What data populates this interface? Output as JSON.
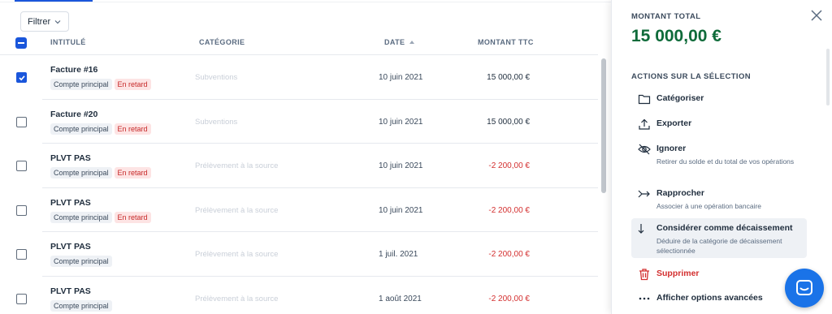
{
  "toolbar": {
    "filter_label": "Filtrer"
  },
  "table": {
    "headers": {
      "title": "INTITULÉ",
      "category": "CATÉGORIE",
      "date": "DATE",
      "amount": "MONTANT TTC"
    },
    "rows": [
      {
        "title": "Facture #16",
        "tags": [
          "Compte principal",
          "En retard"
        ],
        "category": "Subventions",
        "date": "10 juin 2021",
        "amount": "15 000,00 €",
        "negative": false,
        "checked": true
      },
      {
        "title": "Facture #20",
        "tags": [
          "Compte principal",
          "En retard"
        ],
        "category": "Subventions",
        "date": "10 juin 2021",
        "amount": "15 000,00 €",
        "negative": false,
        "checked": false
      },
      {
        "title": "PLVT PAS",
        "tags": [
          "Compte principal",
          "En retard"
        ],
        "category": "Prélèvement à la source",
        "date": "10 juin 2021",
        "amount": "-2 200,00 €",
        "negative": true,
        "checked": false
      },
      {
        "title": "PLVT PAS",
        "tags": [
          "Compte principal",
          "En retard"
        ],
        "category": "Prélèvement à la source",
        "date": "10 juin 2021",
        "amount": "-2 200,00 €",
        "negative": true,
        "checked": false
      },
      {
        "title": "PLVT PAS",
        "tags": [
          "Compte principal"
        ],
        "category": "Prélèvement à la source",
        "date": "1 juil. 2021",
        "amount": "-2 200,00 €",
        "negative": true,
        "checked": false
      },
      {
        "title": "PLVT PAS",
        "tags": [
          "Compte principal"
        ],
        "category": "Prélèvement à la source",
        "date": "1 août 2021",
        "amount": "-2 200,00 €",
        "negative": true,
        "checked": false
      }
    ]
  },
  "panel": {
    "total_label": "MONTANT TOTAL",
    "total_value": "15 000,00 €",
    "actions_label": "ACTIONS SUR LA SÉLECTION",
    "actions": {
      "categorize": {
        "label": "Catégoriser"
      },
      "export": {
        "label": "Exporter"
      },
      "ignore": {
        "label": "Ignorer",
        "desc": "Retirer du solde et du total de vos opérations"
      },
      "reconcile": {
        "label": "Rapprocher",
        "desc": "Associer à une opération bancaire"
      },
      "disbursement": {
        "label": "Considérer comme décaissement",
        "desc": "Déduire de la catégorie de décaissement sélectionnée"
      },
      "delete": {
        "label": "Supprimer"
      },
      "advanced": {
        "label": "Afficher options avancées"
      }
    }
  },
  "colors": {
    "accent": "#1a56db",
    "positive": "#0f6b3a",
    "negative": "#d32f2f",
    "late_tag": "#fde4e4"
  }
}
